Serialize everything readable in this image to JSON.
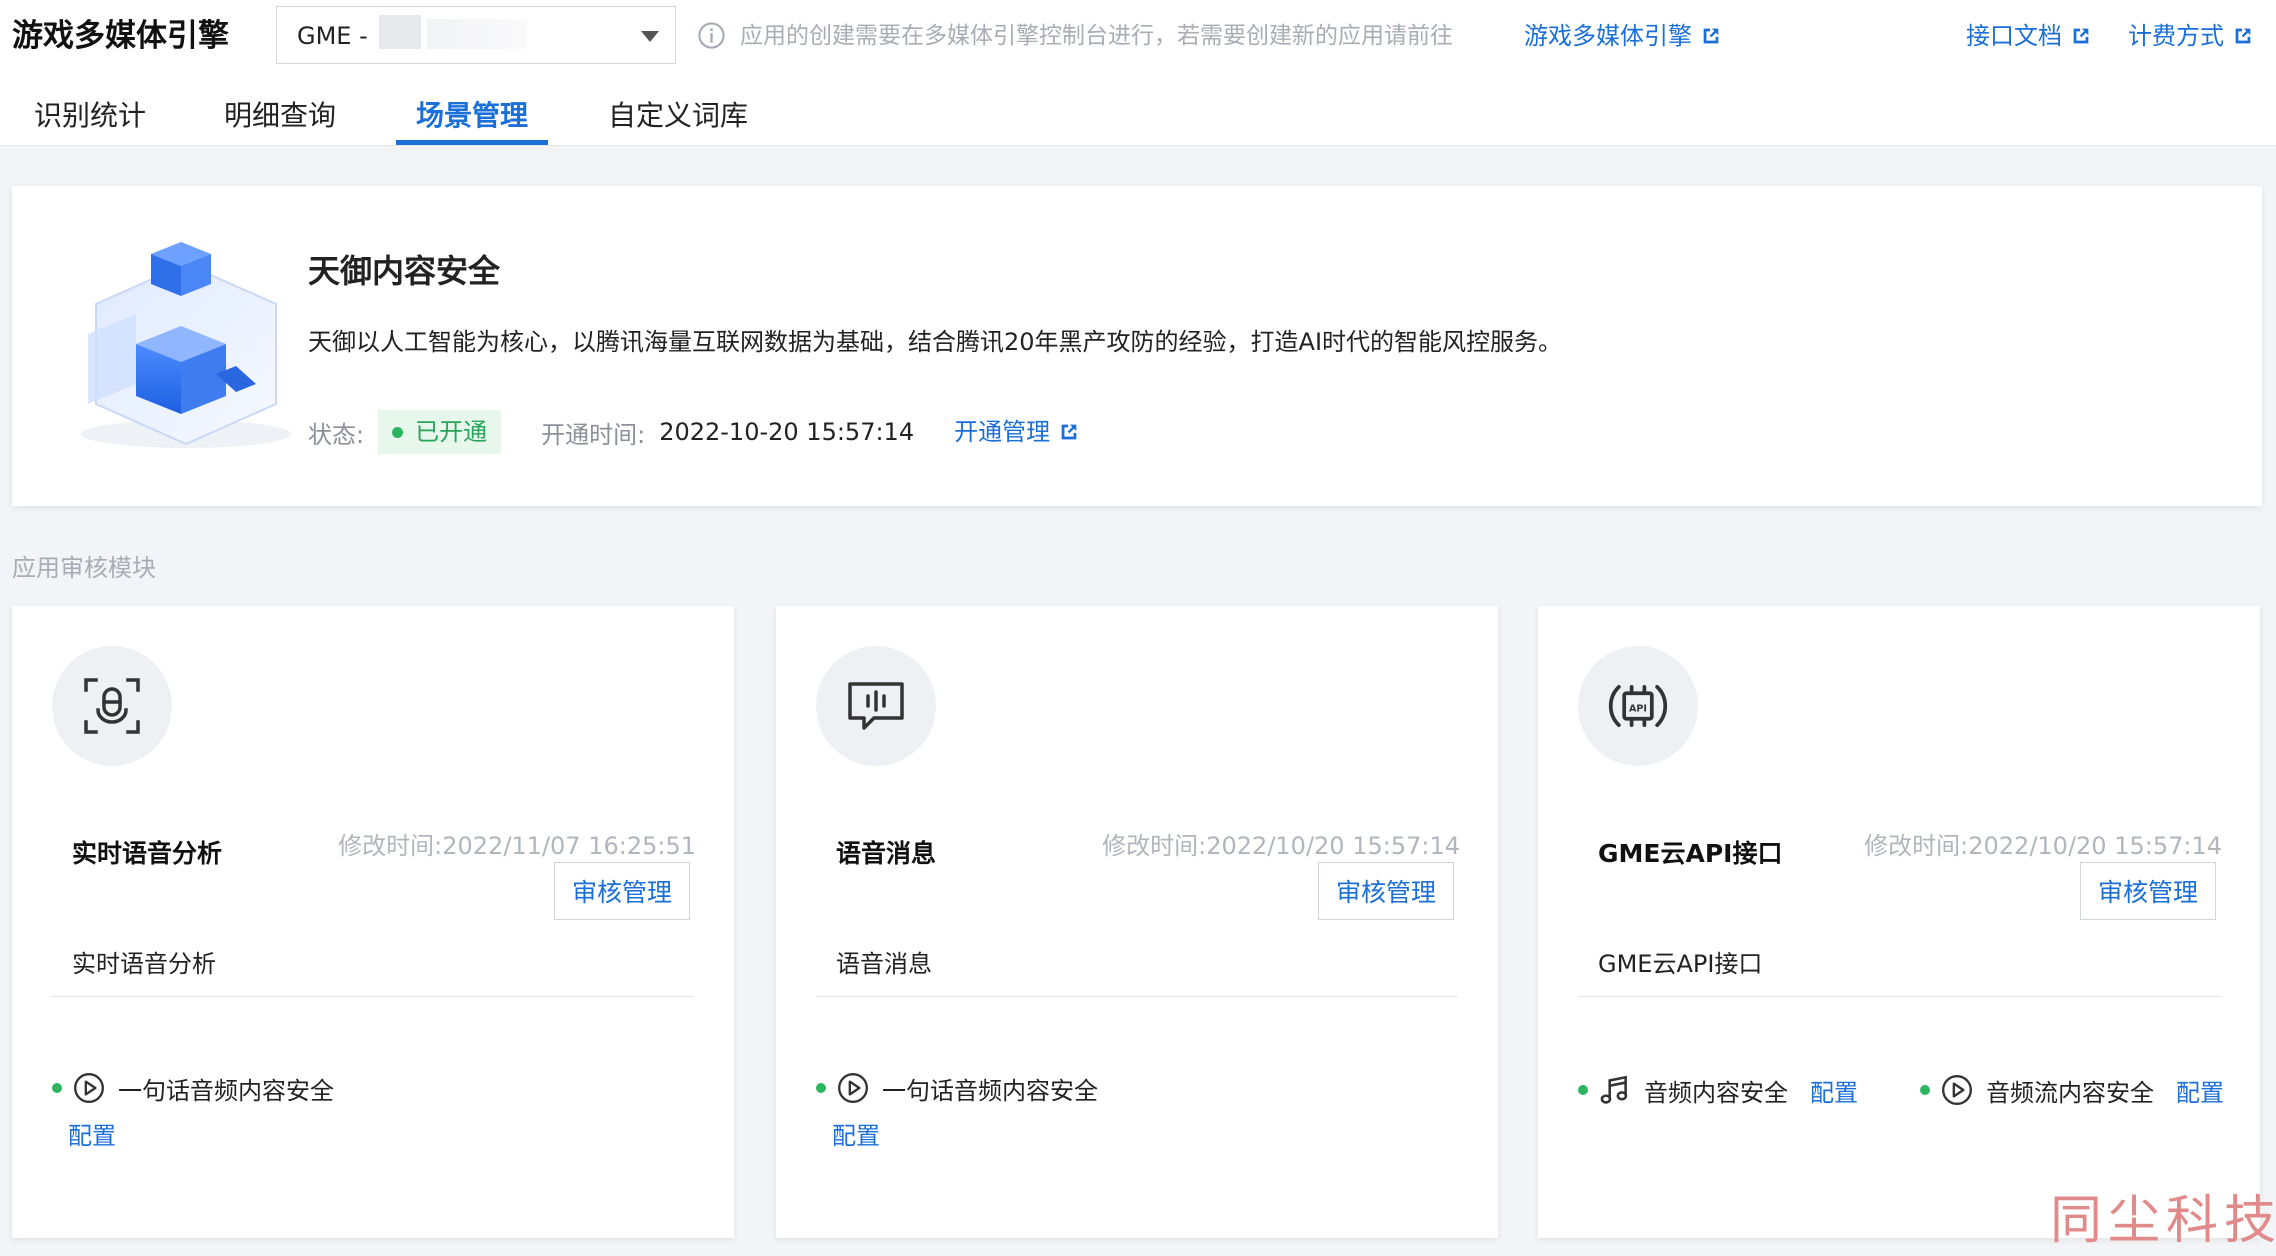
{
  "header": {
    "app_title": "游戏多媒体引擎",
    "app_select_value": "GME -",
    "notice": "应用的创建需要在多媒体引擎控制台进行，若需要创建新的应用请前往",
    "links": {
      "engine": "游戏多媒体引擎",
      "api_docs": "接口文档",
      "billing": "计费方式"
    }
  },
  "tabs": [
    {
      "label": "识别统计"
    },
    {
      "label": "明细查询"
    },
    {
      "label": "场景管理",
      "active": true
    },
    {
      "label": "自定义词库"
    }
  ],
  "banner": {
    "title": "天御内容安全",
    "description": "天御以人工智能为核心，以腾讯海量互联网数据为基础，结合腾讯20年黑产攻防的经验，打造AI时代的智能风控服务。",
    "status_label": "状态:",
    "status_value": "已开通",
    "open_time_label": "开通时间:",
    "open_time_value": "2022-10-20 15:57:14",
    "manage_link": "开通管理"
  },
  "section_label": "应用审核模块",
  "cards": [
    {
      "icon": "voice-recognition-icon",
      "title": "实时语音分析",
      "modified": "修改时间:2022/11/07 16:25:51",
      "button": "审核管理",
      "description": "实时语音分析",
      "features": [
        {
          "icon": "play-circle-icon",
          "label": "一句话音频内容安全",
          "config": "配置"
        }
      ]
    },
    {
      "icon": "voice-message-icon",
      "title": "语音消息",
      "modified": "修改时间:2022/10/20 15:57:14",
      "button": "审核管理",
      "description": "语音消息",
      "features": [
        {
          "icon": "play-circle-icon",
          "label": "一句话音频内容安全",
          "config": "配置"
        }
      ]
    },
    {
      "icon": "api-icon",
      "title": "GME云API接口",
      "modified": "修改时间:2022/10/20 15:57:14",
      "button": "审核管理",
      "description": "GME云API接口",
      "features": [
        {
          "icon": "music-note-icon",
          "label": "音频内容安全",
          "config": "配置"
        },
        {
          "icon": "play-circle-icon",
          "label": "音频流内容安全",
          "config": "配置"
        }
      ]
    }
  ],
  "watermark": "同尘科技",
  "colors": {
    "accent": "#1a6fd8",
    "status_green": "#2bb55f",
    "background": "#f3f4f7"
  }
}
